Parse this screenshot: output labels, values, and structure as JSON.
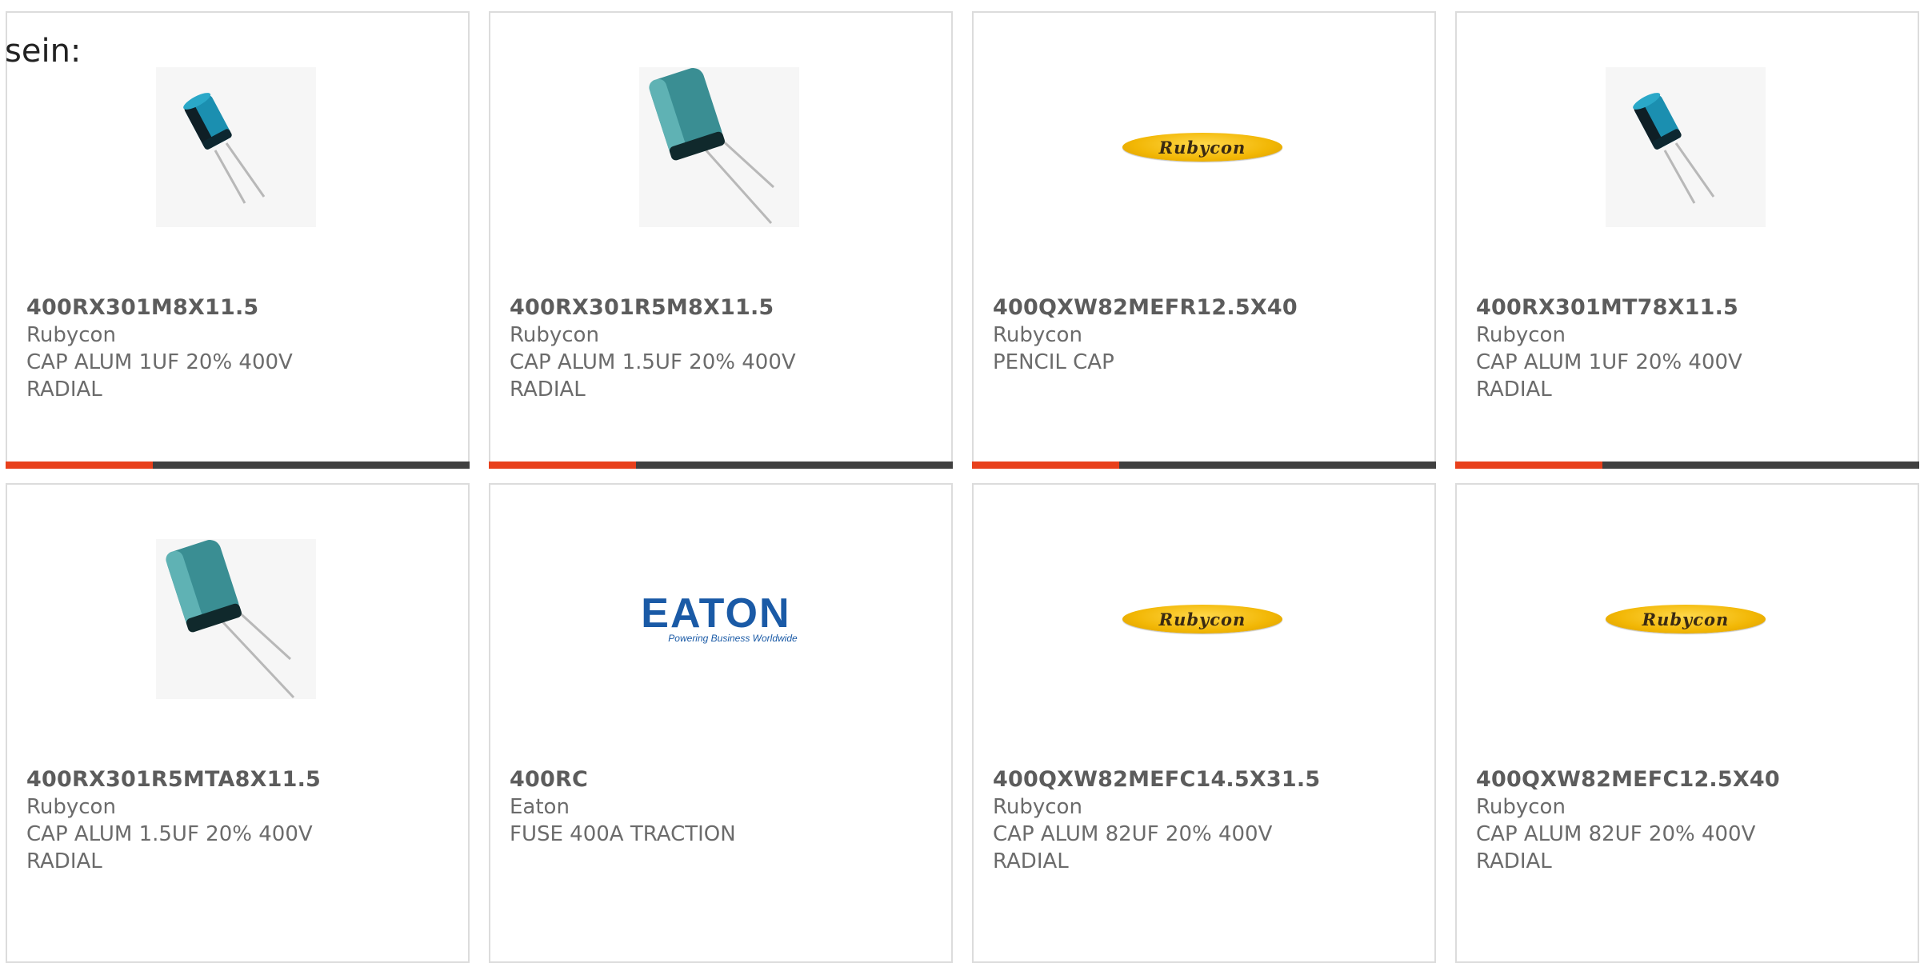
{
  "page": {
    "lead_text": "sein:"
  },
  "colors": {
    "accent": "#e8401c",
    "bar": "#404040",
    "eaton_blue": "#1a5aa6",
    "rubycon_yellow": "#f2b705"
  },
  "products": [
    {
      "part": "400RX301M8X11.5",
      "maker": "Rubycon",
      "desc1": "CAP ALUM 1UF 20% 400V",
      "desc2": "RADIAL",
      "image": "capacitor-small-icon"
    },
    {
      "part": "400RX301R5M8X11.5",
      "maker": "Rubycon",
      "desc1": "CAP ALUM 1.5UF 20% 400V",
      "desc2": "RADIAL",
      "image": "capacitor-large-icon"
    },
    {
      "part": "400QXW82MEFR12.5X40",
      "maker": "Rubycon",
      "desc1": "PENCIL CAP",
      "desc2": "",
      "image": "rubycon-logo",
      "logo_text": "Rubycon"
    },
    {
      "part": "400RX301MT78X11.5",
      "maker": "Rubycon",
      "desc1": "CAP ALUM 1UF 20% 400V",
      "desc2": "RADIAL",
      "image": "capacitor-small-icon"
    },
    {
      "part": "400RX301R5MTA8X11.5",
      "maker": "Rubycon",
      "desc1": "CAP ALUM 1.5UF 20% 400V",
      "desc2": "RADIAL",
      "image": "capacitor-large-icon"
    },
    {
      "part": "400RC",
      "maker": "Eaton",
      "desc1": "FUSE 400A TRACTION",
      "desc2": "",
      "image": "eaton-logo",
      "logo_text": "EATON",
      "logo_tagline": "Powering Business Worldwide"
    },
    {
      "part": "400QXW82MEFC14.5X31.5",
      "maker": "Rubycon",
      "desc1": "CAP ALUM 82UF 20% 400V",
      "desc2": "RADIAL",
      "image": "rubycon-logo",
      "logo_text": "Rubycon"
    },
    {
      "part": "400QXW82MEFC12.5X40",
      "maker": "Rubycon",
      "desc1": "CAP ALUM 82UF 20% 400V",
      "desc2": "RADIAL",
      "image": "rubycon-logo",
      "logo_text": "Rubycon"
    }
  ]
}
